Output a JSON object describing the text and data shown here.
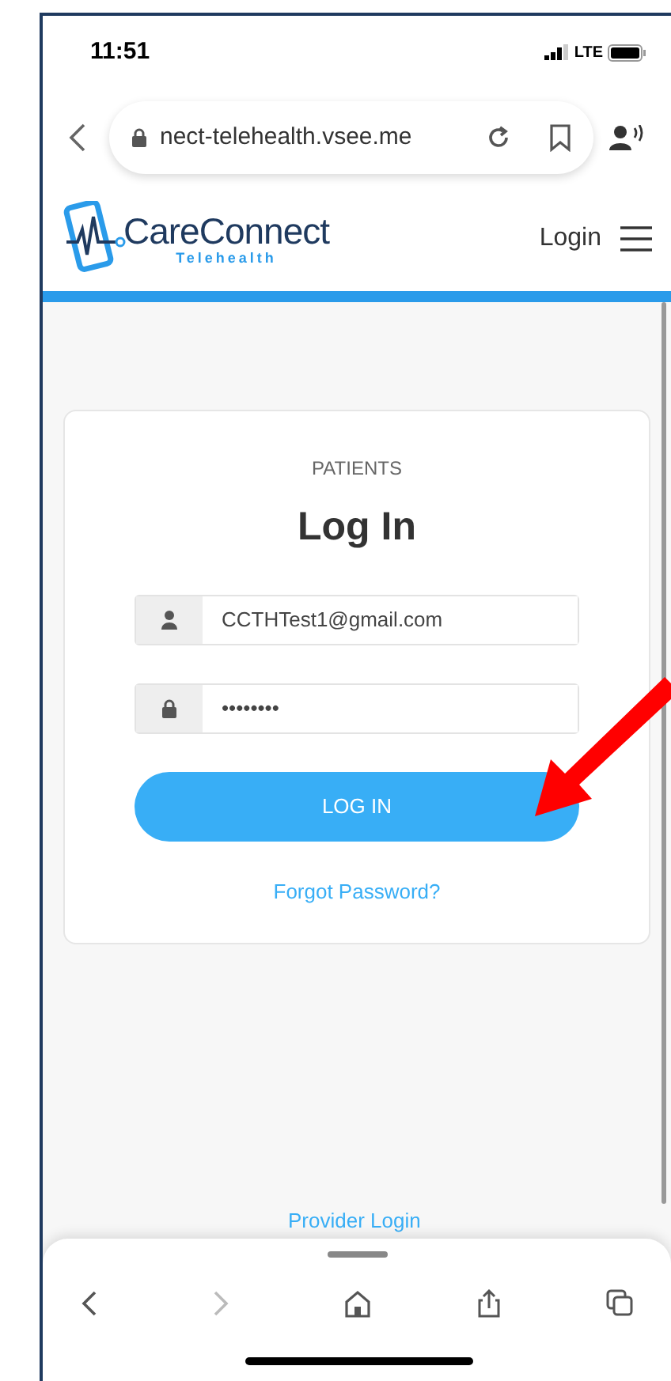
{
  "status_bar": {
    "time": "11:51",
    "network": "LTE"
  },
  "browser": {
    "url": "nect-telehealth.vsee.me"
  },
  "header": {
    "logo_name": "CareConnect",
    "logo_tagline": "Telehealth",
    "login_link": "Login"
  },
  "login_card": {
    "section": "PATIENTS",
    "title": "Log In",
    "fields": [
      {
        "kind": "user",
        "value": "CCTHTest1@gmail.com"
      },
      {
        "kind": "lock",
        "value": "••••••••"
      }
    ],
    "submit": "LOG IN",
    "forgot_link": "Forgot Password?"
  },
  "provider_link": "Provider Login",
  "toolbar": [
    {
      "kind": "back",
      "disabled": false
    },
    {
      "kind": "forward",
      "disabled": true
    },
    {
      "kind": "home",
      "disabled": false
    },
    {
      "kind": "share",
      "disabled": false
    },
    {
      "kind": "tabs",
      "disabled": false
    }
  ]
}
